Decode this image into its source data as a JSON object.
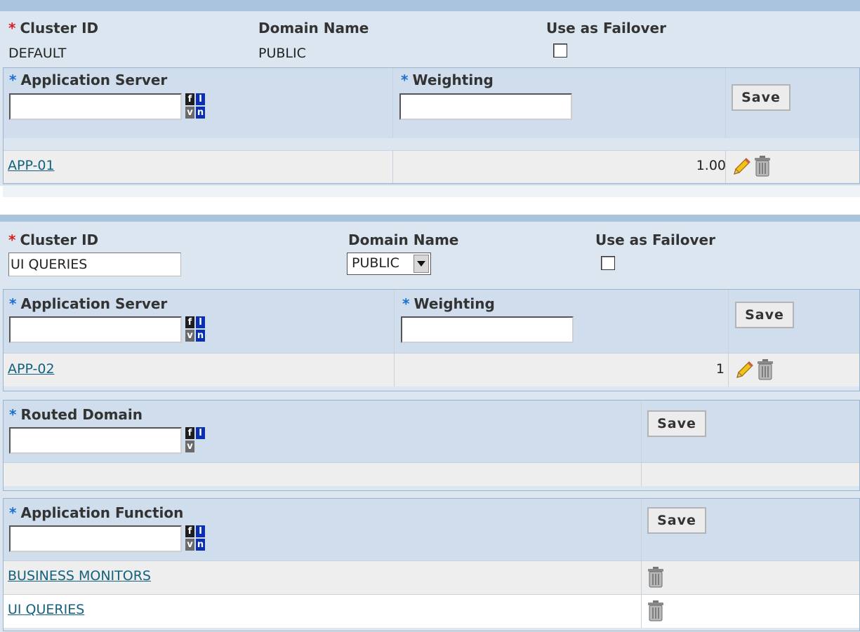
{
  "panel1": {
    "cluster_id_label": "Cluster ID",
    "cluster_id_value": "DEFAULT",
    "domain_name_label": "Domain Name",
    "domain_name_value": "PUBLIC",
    "failover_label": "Use as Failover",
    "failover_checked": false,
    "app_server_grid": {
      "app_server_label": "Application Server",
      "weighting_label": "Weighting",
      "save_label": "Save",
      "rows": [
        {
          "server": "APP-01",
          "weighting": "1.00"
        }
      ]
    }
  },
  "panel2": {
    "cluster_id_label": "Cluster ID",
    "cluster_id_value": "UI QUERIES",
    "domain_name_label": "Domain Name",
    "domain_name_value": "PUBLIC",
    "failover_label": "Use as Failover",
    "failover_checked": false,
    "app_server_grid": {
      "app_server_label": "Application Server",
      "weighting_label": "Weighting",
      "save_label": "Save",
      "rows": [
        {
          "server": "APP-02",
          "weighting": "1"
        }
      ]
    },
    "routed_domain_grid": {
      "label": "Routed Domain",
      "save_label": "Save"
    },
    "app_function_grid": {
      "label": "Application Function",
      "save_label": "Save",
      "rows": [
        {
          "function": "BUSINESS MONITORS"
        },
        {
          "function": "UI QUERIES"
        }
      ]
    }
  },
  "icons": {
    "required": "asterisk",
    "edit": "pencil-icon",
    "delete": "trash-icon",
    "lookup": "prompt-lookup-icon",
    "dropdown": "triangle-down-icon"
  },
  "colors": {
    "required_red": "#d71e1e",
    "required_blue": "#1a6fd0",
    "link": "#14617f",
    "panel_bg": "#dce6f0",
    "header_bg": "#cfddec"
  }
}
